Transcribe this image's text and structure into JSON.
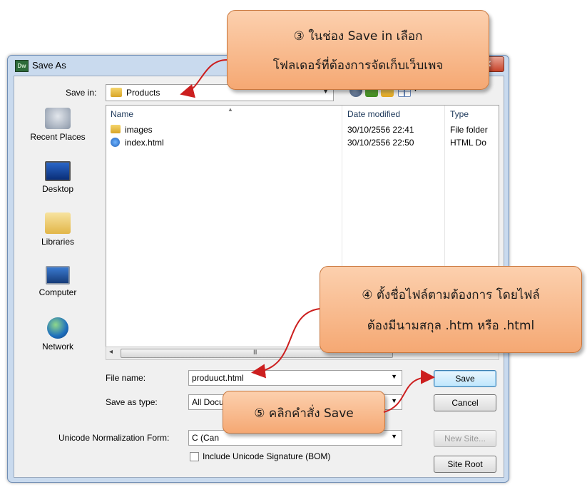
{
  "window": {
    "title": "Save As",
    "app_icon_text": "Dw",
    "close_symbol": "✕"
  },
  "save_in": {
    "label": "Save in:",
    "value": "Products"
  },
  "places": [
    {
      "label": "Recent Places",
      "icon": "recent-places-icon"
    },
    {
      "label": "Desktop",
      "icon": "desktop-icon"
    },
    {
      "label": "Libraries",
      "icon": "libraries-icon"
    },
    {
      "label": "Computer",
      "icon": "computer-icon"
    },
    {
      "label": "Network",
      "icon": "network-icon"
    }
  ],
  "file_list": {
    "columns": [
      "Name",
      "Date modified",
      "Type"
    ],
    "rows": [
      {
        "name": "images",
        "date": "30/10/2556 22:41",
        "type": "File folder",
        "icon": "folder-icon"
      },
      {
        "name": "index.html",
        "date": "30/10/2556 22:50",
        "type": "HTML Do",
        "icon": "html-file-icon"
      }
    ],
    "scroll_grip": "III"
  },
  "form": {
    "file_name_label": "File name:",
    "file_name_value": "produuct.html",
    "save_as_type_label": "Save as type:",
    "save_as_type_value": "All Docu",
    "unicode_label": "Unicode Normalization Form:",
    "unicode_value": "C (Can",
    "bom_label": "Include Unicode Signature (BOM)"
  },
  "buttons": {
    "save": "Save",
    "cancel": "Cancel",
    "new_site": "New Site...",
    "site_root": "Site Root"
  },
  "callouts": {
    "step3": [
      "③ ในช่อง Save in เลือก",
      "โฟลเดอร์ที่ต้องการจัดเก็บเว็บเพจ"
    ],
    "step4": [
      "④ ตั้งชื่อไฟล์ตามต้องการ โดยไฟล์",
      "ต้องมีนามสกุล .htm หรือ .html"
    ],
    "step5": [
      "⑤ คลิกคำสั่ง Save"
    ]
  },
  "colors": {
    "callout_fill": "#f8b486",
    "arrow": "#cc1f1f",
    "dialog_frame": "#c9daee"
  }
}
